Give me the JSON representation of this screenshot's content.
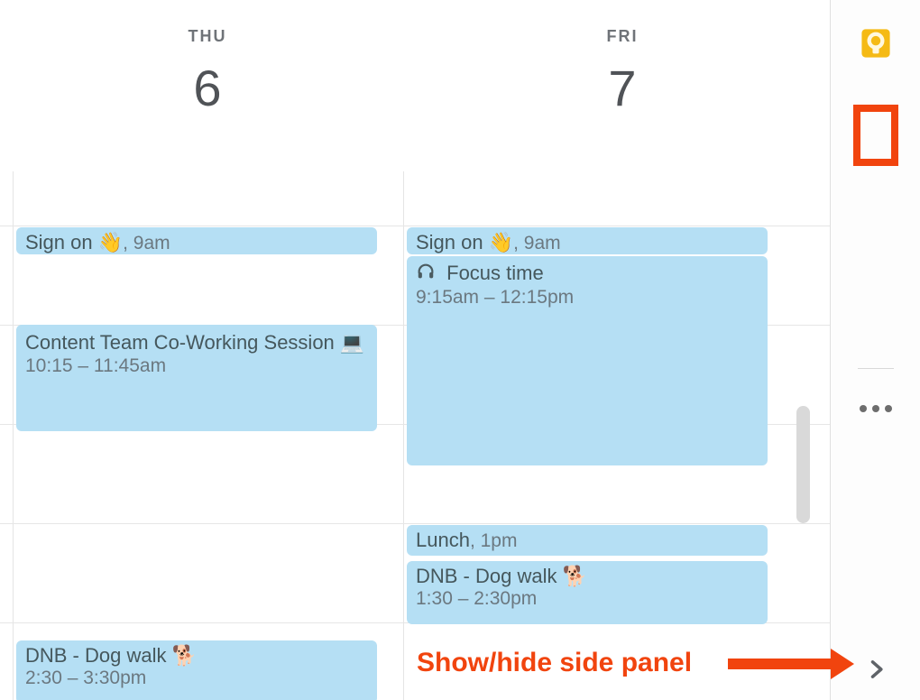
{
  "side_panel": {
    "apps": {
      "keep": "keep-icon",
      "tasks": "tasks-icon",
      "contacts": "contacts-icon",
      "maps": "maps-icon"
    },
    "more": "more-apps-icon",
    "expand": "chevron-right-icon"
  },
  "annotation": {
    "label": "Show/hide side panel"
  },
  "calendar": {
    "days": [
      {
        "dow": "THU",
        "num": "6"
      },
      {
        "dow": "FRI",
        "num": "7"
      }
    ],
    "events": {
      "thu_signon": {
        "title": "Sign on 👋",
        "time": "9am"
      },
      "thu_cowork": {
        "title": "Content Team Co-Working Session 💻",
        "time": "10:15 – 11:45am"
      },
      "thu_walk": {
        "title": "DNB - Dog walk 🐕",
        "time": "2:30 – 3:30pm"
      },
      "fri_signon": {
        "title": "Sign on 👋",
        "time": "9am"
      },
      "fri_focus": {
        "title": "Focus time",
        "time": "9:15am – 12:15pm"
      },
      "fri_lunch": {
        "title": "Lunch",
        "time": "1pm"
      },
      "fri_walk": {
        "title": "DNB - Dog walk 🐕",
        "time": "1:30 – 2:30pm"
      }
    }
  }
}
